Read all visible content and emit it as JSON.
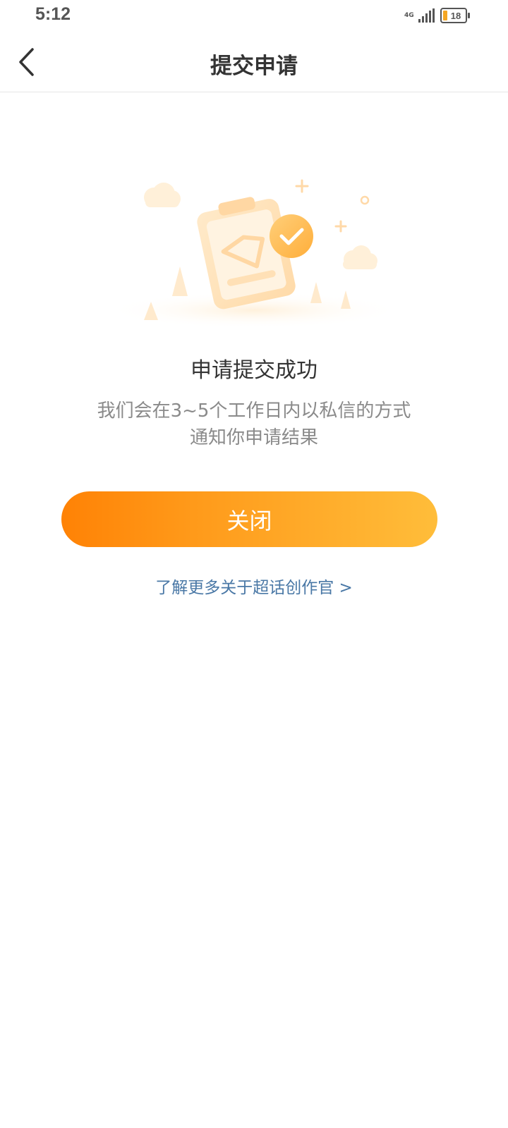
{
  "status_bar": {
    "time": "5:12",
    "network": "4G",
    "battery": "18"
  },
  "nav": {
    "title": "提交申请"
  },
  "result": {
    "title": "申请提交成功",
    "description_line1": "我们会在3~5个工作日内以私信的方式",
    "description_line2": "通知你申请结果"
  },
  "actions": {
    "close_label": "关闭",
    "learn_more_label": "了解更多关于超话创作官 >"
  },
  "colors": {
    "accent_start": "#ff8205",
    "accent_end": "#ffbd3a",
    "link": "#4a78a6"
  },
  "icons": [
    "back-arrow-icon",
    "clipboard-icon",
    "check-badge-icon",
    "signal-icon",
    "battery-icon"
  ]
}
